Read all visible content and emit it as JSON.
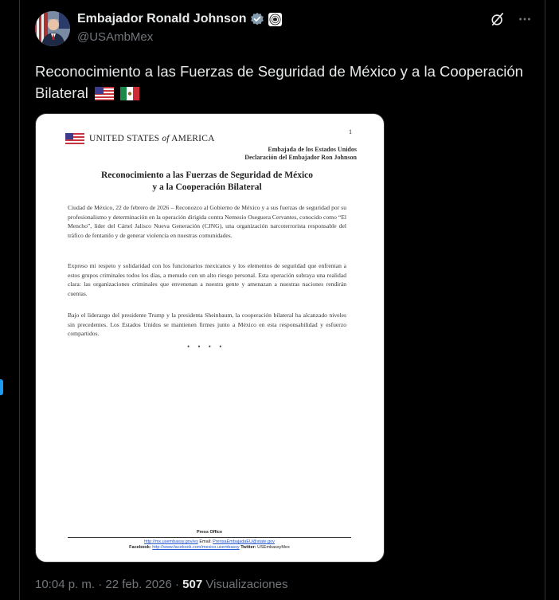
{
  "author": {
    "name": "Embajador Ronald Johnson",
    "handle": "@USAmbMex"
  },
  "post": {
    "text": "Reconocimiento a las Fuerzas de Seguridad de México y a la Cooperación Bilateral"
  },
  "document": {
    "country_lead": "UNITED STATES",
    "country_of": "of",
    "country_tail": "AMERICA",
    "page_number": "1",
    "embassy_line1": "Embajada de los Estados Unidos",
    "embassy_line2": "Declaración del Embajador Ron Johnson",
    "title_line1": "Reconocimiento a las Fuerzas de Seguridad de México",
    "title_line2": "y a la Cooperación Bilateral",
    "paragraph1": "Ciudad de México, 22 de febrero de 2026 – Reconozco al Gobierno de México y a sus fuerzas de seguridad por su profesionalismo y determinación en la operación dirigida contra Nemesio Oseguera Cervantes, conocido como “El Mencho”, líder del Cártel Jalisco Nueva Generación (CJNG), una organización narcoterrorista responsable del tráfico de fentanilo y de generar violencia en nuestras comunidades.",
    "paragraph2": "Expreso mi respeto y solidaridad con los funcionarios mexicanos y los elementos de seguridad que enfrentan a estos grupos criminales todos los días, a menudo con un alto riesgo personal. Esta operación subraya una realidad clara: las organizaciones criminales que envenenan a nuestra gente y amenazan a nuestras naciones rendirán cuentas.",
    "paragraph3": "Bajo el liderazgo del presidente Trump y la presidenta Sheinbaum, la cooperación bilateral ha alcanzado niveles sin precedentes. Los Estados Unidos se mantienen firmes junto a México en esta responsabilidad y esfuerzo compartidos.",
    "separator": "• • • •",
    "footer_title": "Press Office",
    "footer_web": "http://mx.usembassy.gov/es",
    "footer_email_label": "Email:",
    "footer_email": "PrensaEmbajadaEU@state.gov",
    "footer_facebook_label": "Facebook:",
    "footer_facebook": "http://www.facebook.com/mexico.usembassy",
    "footer_twitter_label": "Twitter:",
    "footer_twitter": "USEmbassyMex"
  },
  "meta": {
    "time": "10:04 p. m.",
    "sep1": " · ",
    "date": "22 feb. 2026",
    "sep2": " · ",
    "views": "507",
    "views_label": " Visualizaciones"
  },
  "icons": {
    "verified": "verified-badge-icon",
    "affiliation": "embassy-seal-icon",
    "grok": "grok-icon",
    "more": "more-icon",
    "flag_us": "us-flag-icon",
    "flag_mx": "mexico-flag-icon"
  },
  "colors": {
    "background": "#000000",
    "text": "#e7e9ea",
    "muted": "#71767b",
    "accent": "#1d9bf0"
  }
}
